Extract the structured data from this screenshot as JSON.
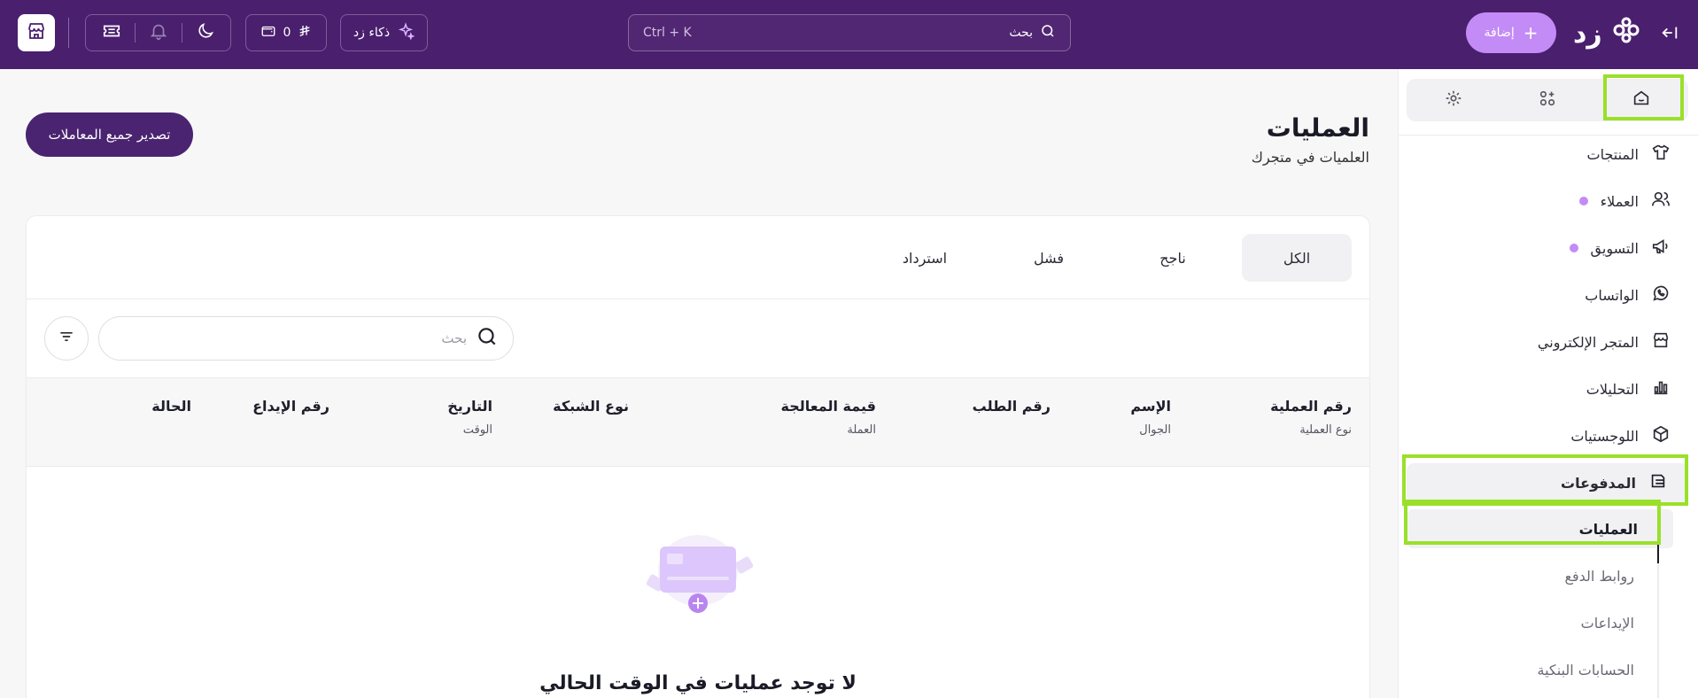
{
  "topbar": {
    "brand_name": "زد",
    "add_label": "إضافة",
    "search_label": "بحث",
    "search_shortcut": "Ctrl + K",
    "ai_label": "ذكاء زد",
    "wallet_amount": "0",
    "icons": {
      "store": "store-icon",
      "moon": "moon-icon",
      "bell": "bell-icon",
      "ticket": "ticket-icon",
      "wallet": "wallet-icon",
      "currency": "riyal-icon",
      "sparkle": "sparkle-icon",
      "search": "search-icon",
      "plus": "plus-icon",
      "collapse": "collapse-arrow-icon"
    },
    "colors": {
      "bar": "#4a1f6e",
      "accent": "#c38bf5"
    }
  },
  "page": {
    "title": "العمليات",
    "subtitle": "العلميات في متجرك",
    "export_label": "تصدير جميع المعاملات"
  },
  "tabs": [
    "الكل",
    "ناجح",
    "فشل",
    "استرداد"
  ],
  "table": {
    "search_placeholder": "بحث",
    "columns": [
      {
        "main": "رقم العملية",
        "sub": "نوع العملية"
      },
      {
        "main": "الإسم",
        "sub": "الجوال"
      },
      {
        "main": "رقم الطلب",
        "sub": ""
      },
      {
        "main": "قيمة المعالجة",
        "sub": "العملة"
      },
      {
        "main": "نوع الشبكة",
        "sub": ""
      },
      {
        "main": "التاريخ",
        "sub": "الوقت"
      },
      {
        "main": "رقم الإيداع",
        "sub": ""
      },
      {
        "main": "الحالة",
        "sub": ""
      }
    ],
    "empty_message": "لا توجد عمليات في الوقت الحالي"
  },
  "sidebar": {
    "items": [
      {
        "label": "المنتجات",
        "icon": "shirt-icon"
      },
      {
        "label": "العملاء",
        "icon": "users-icon"
      },
      {
        "label": "التسويق",
        "icon": "megaphone-icon"
      },
      {
        "label": "الواتساب",
        "icon": "whatsapp-icon"
      },
      {
        "label": "المتجر الإلكتروني",
        "icon": "storefront-icon"
      },
      {
        "label": "التحليلات",
        "icon": "bar-chart-icon"
      },
      {
        "label": "اللوجستيات",
        "icon": "box-icon"
      },
      {
        "label": "المدفوعات",
        "icon": "payments-icon"
      }
    ],
    "subitems": [
      "العمليات",
      "روابط الدفع",
      "الإيداعات",
      "الحسابات البنكية"
    ]
  }
}
